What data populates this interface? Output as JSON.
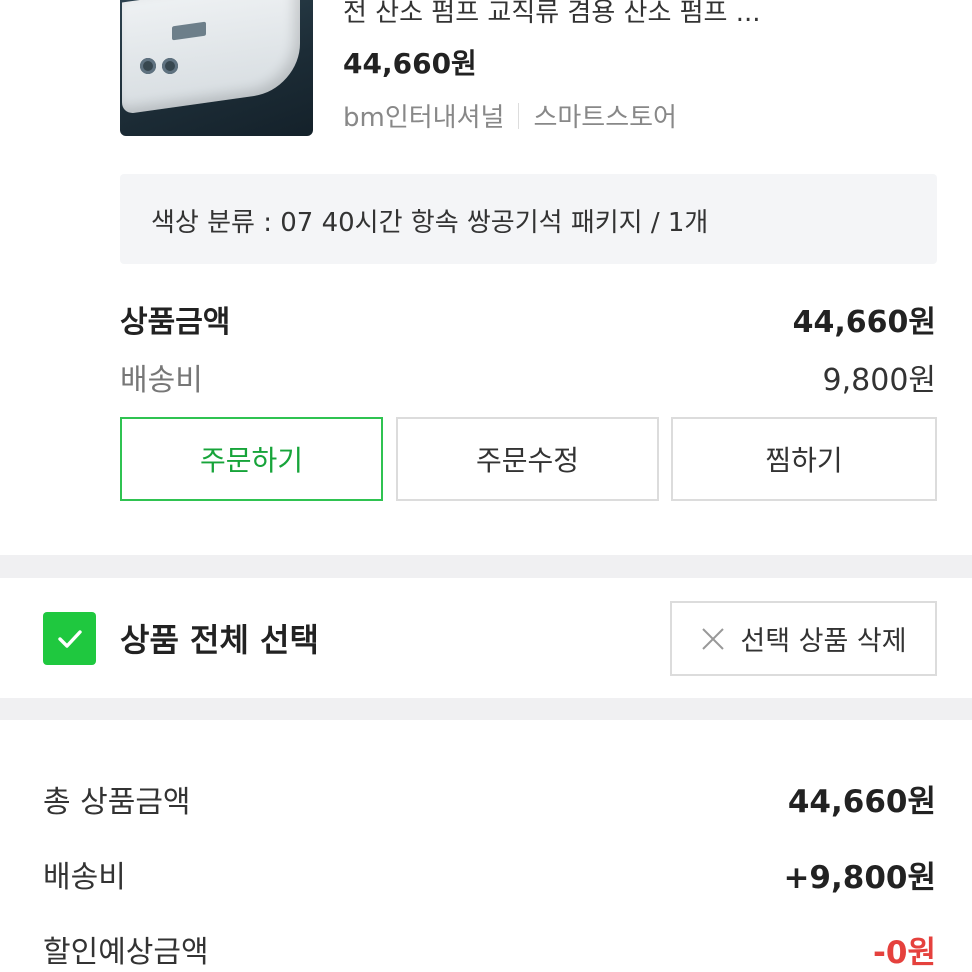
{
  "product": {
    "title": "전 산소 펌프 교직류 겸용 산소 펌프 ...",
    "price": "44,660원",
    "seller": "bm인터내셔널",
    "store_type": "스마트스토어",
    "option": "색상 분류 : 07 40시간 항속 쌍공기석 패키지 / 1개"
  },
  "item_summary": {
    "amount_label": "상품금액",
    "amount_value": "44,660원",
    "shipping_label": "배송비",
    "shipping_value": "9,800원"
  },
  "actions": {
    "order": "주문하기",
    "modify": "주문수정",
    "wish": "찜하기"
  },
  "selection": {
    "select_all": "상품 전체 선택",
    "delete_selected": "선택 상품 삭제",
    "checked": true
  },
  "totals": {
    "total_label": "총 상품금액",
    "total_value": "44,660원",
    "shipping_label": "배송비",
    "shipping_value": "+9,800원",
    "discount_label": "할인예상금액",
    "discount_value": "-0원"
  },
  "colors": {
    "accent_green": "#1fc83f",
    "discount_red": "#e5413d"
  },
  "icons": [
    "check-icon",
    "close-icon"
  ]
}
